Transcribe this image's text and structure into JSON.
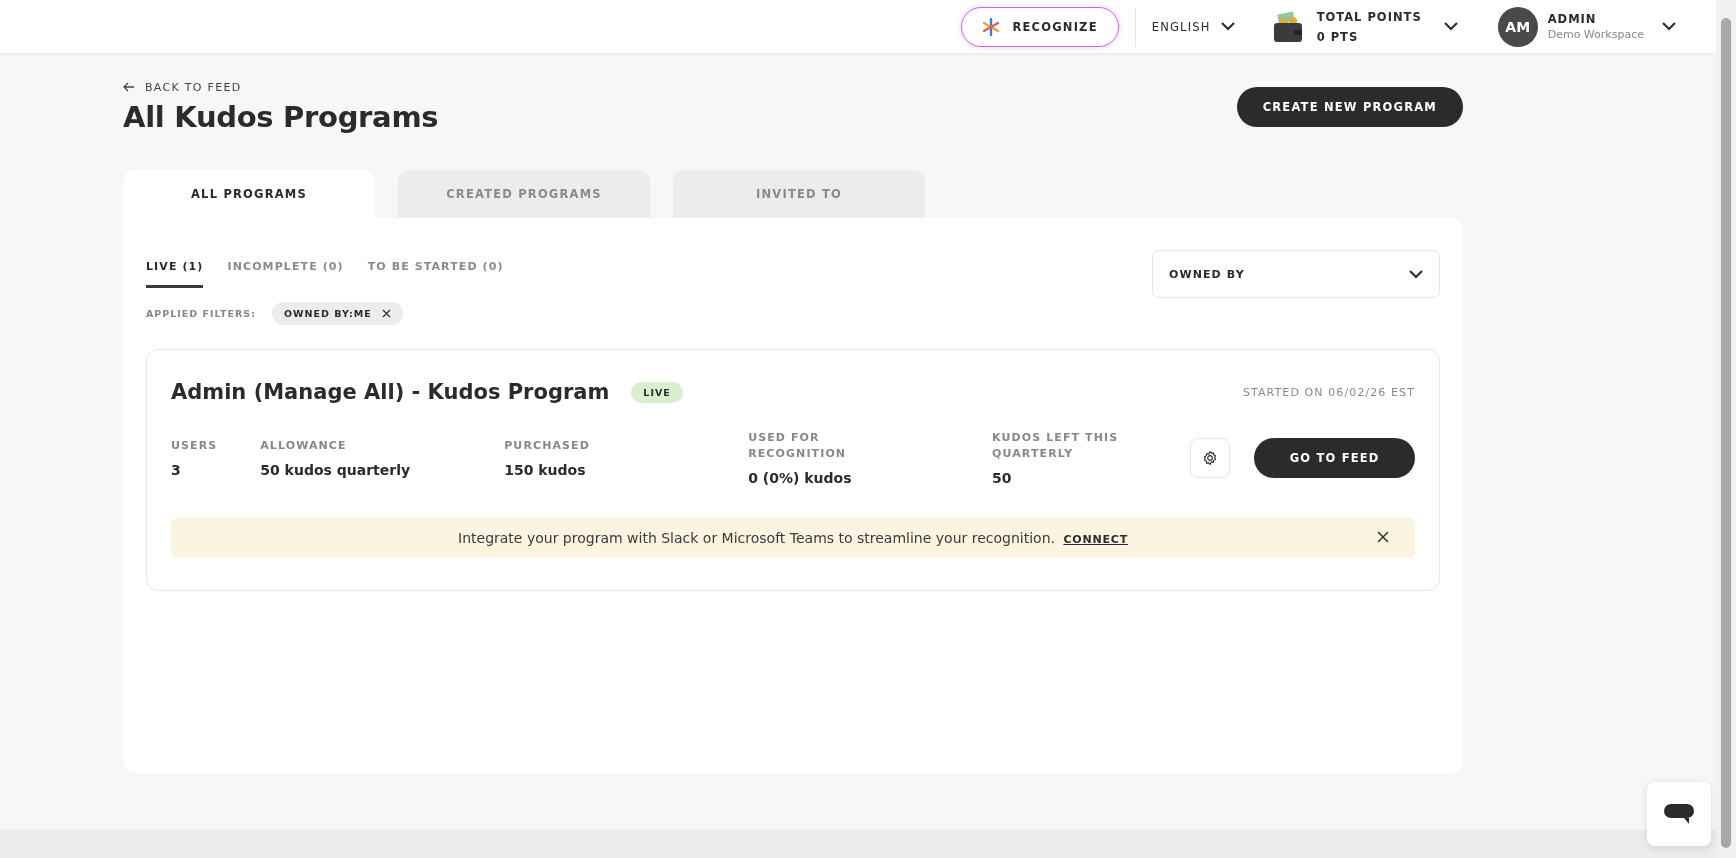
{
  "topbar": {
    "recognize_button": "RECOGNIZE",
    "language": "ENGLISH",
    "points": {
      "label": "TOTAL POINTS",
      "value": "0 PTS"
    },
    "user": {
      "initials": "AM",
      "name": "ADMIN",
      "workspace": "Demo Workspace"
    }
  },
  "header": {
    "back_link": "BACK TO FEED",
    "title": "All Kudos Programs",
    "create_button": "CREATE NEW PROGRAM"
  },
  "tabs": [
    {
      "label": "ALL PROGRAMS",
      "selected": true
    },
    {
      "label": "CREATED PROGRAMS",
      "selected": false
    },
    {
      "label": "INVITED TO",
      "selected": false
    }
  ],
  "status_tabs": [
    {
      "label": "LIVE (1)",
      "selected": true
    },
    {
      "label": "INCOMPLETE (0)",
      "selected": false
    },
    {
      "label": "TO BE STARTED (0)",
      "selected": false
    }
  ],
  "owned_by_dropdown": {
    "label": "OWNED BY"
  },
  "applied_filters": {
    "label": "APPLIED FILTERS:",
    "chips": [
      {
        "label": "OWNED BY:ME"
      }
    ]
  },
  "programs": [
    {
      "title": "Admin (Manage All) - Kudos Program",
      "status": "LIVE",
      "started": "STARTED ON 06/02/26 EST",
      "stats": [
        {
          "label": "USERS",
          "value": "3"
        },
        {
          "label": "ALLOWANCE",
          "value": "50 kudos quarterly"
        },
        {
          "label": "PURCHASED",
          "value": "150 kudos"
        },
        {
          "label": "USED FOR RECOGNITION",
          "value": "0 (0%) kudos"
        },
        {
          "label": "KUDOS LEFT THIS QUARTERLY",
          "value": "50"
        }
      ],
      "action_button": "GO TO FEED",
      "banner": {
        "text": "Integrate your program with Slack or Microsoft Teams to streamline your recognition.",
        "link": "CONNECT"
      }
    }
  ]
}
